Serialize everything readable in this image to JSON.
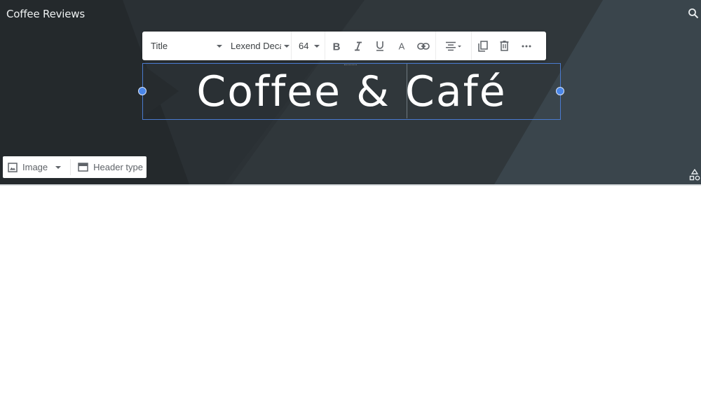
{
  "site": {
    "title": "Coffee Reviews",
    "search_icon": "search-icon"
  },
  "toolbar": {
    "style_select": {
      "value": "Title"
    },
    "font_select": {
      "value": "Lexend Deca"
    },
    "size_select": {
      "value": "64"
    },
    "buttons": [
      {
        "name": "bold",
        "icon": "bold-icon"
      },
      {
        "name": "italic",
        "icon": "italic-icon"
      },
      {
        "name": "underline",
        "icon": "underline-icon"
      },
      {
        "name": "text-color",
        "icon": "text-color-icon"
      },
      {
        "name": "link",
        "icon": "link-icon"
      },
      {
        "name": "align",
        "icon": "align-center-icon"
      },
      {
        "name": "duplicate",
        "icon": "copy-icon"
      },
      {
        "name": "delete",
        "icon": "trash-icon"
      },
      {
        "name": "more",
        "icon": "more-horizontal-icon"
      }
    ]
  },
  "header_title": {
    "text": "Coffee & Café"
  },
  "header_controls": {
    "image_label": "Image",
    "header_type_label": "Header type"
  },
  "colors": {
    "header_bg": "#2c3236",
    "selection": "#4a7bd0",
    "handle": "#4a86e8"
  }
}
